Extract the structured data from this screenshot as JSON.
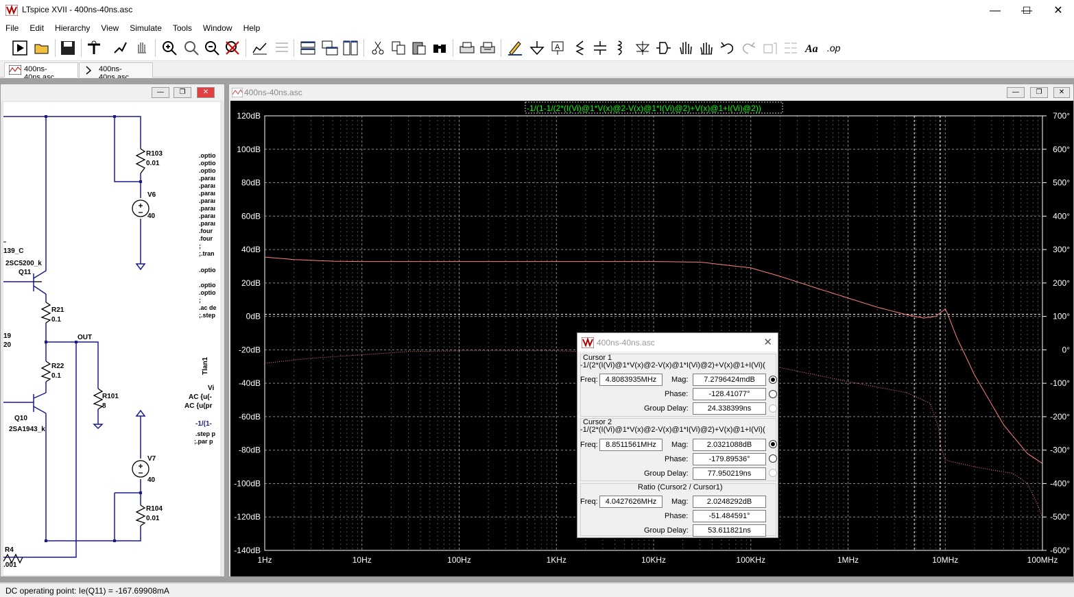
{
  "window": {
    "title": "LTspice XVII - 400ns-40ns.asc",
    "minimize": "—",
    "maximize": "☐",
    "close": "✕"
  },
  "menu": [
    "File",
    "Edit",
    "Hierarchy",
    "View",
    "Simulate",
    "Tools",
    "Window",
    "Help"
  ],
  "tabs": [
    {
      "label": "400ns-40ns.asc",
      "icon": "waveform-icon"
    },
    {
      "label": "400ns-40ns.asc",
      "icon": "schematic-icon"
    }
  ],
  "schematic": {
    "labels": {
      "r103": "R103",
      "r103v": "0.01",
      "v6": "V6",
      "v6v": "40",
      "q139": "139_C",
      "q11m": "2SC5200_k",
      "q11": "Q11",
      "r21": "R21",
      "r21v": "0.1",
      "r19": "19",
      "r19v": "20",
      "out": "OUT",
      "r22": "R22",
      "r22v": "0.1",
      "r101": "R101",
      "r101v": "8",
      "q10": "Q10",
      "q10m": "2SA1943_k",
      "v7": "V7",
      "v7v": "40",
      "r104": "R104",
      "r104v": "0.01",
      "r4": "R4",
      "r4v": ".001",
      "vi": "Vi",
      "ac1": "AC {u(-",
      "ac2": "AC {u(pr",
      "tlan": "Tlan1",
      "expr": "-1/(1-",
      "step1": ".step p",
      "par": ";.par p"
    },
    "directives": [
      ".optio",
      ".optio",
      ".optio",
      ".paraı",
      ".paraı",
      ".paraı",
      ".paraı",
      ".paraı",
      ".paraı",
      ".paraı",
      ".four",
      ".four",
      ";",
      ";.tran",
      "",
      ".optio",
      "",
      ".optio",
      ".optio",
      ";",
      ".ac de",
      ";.step"
    ]
  },
  "plot": {
    "window_title": "400ns-40ns.asc",
    "expression": "-1/(1-1/(2*(I(Vi)@1*V(x)@2-V(x)@1*I(Vi)@2)+V(x)@1+I(Vi)@2))",
    "colors": {
      "background": "#000000",
      "grid": "#8c8c8c",
      "trace": "#ff8080",
      "expr": "#00ff00"
    }
  },
  "chart_data": {
    "type": "line",
    "title": "-1/(1-1/(2*(I(Vi)@1*V(x)@2-V(x)@1*I(Vi)@2)+V(x)@1+I(Vi)@2))",
    "x_scale": "log",
    "xlim": [
      1,
      100000000
    ],
    "x_ticks": [
      "1Hz",
      "10Hz",
      "100Hz",
      "1KHz",
      "10KHz",
      "100KHz",
      "1MHz",
      "10MHz",
      "100MHz"
    ],
    "ylim_left": [
      -140,
      120
    ],
    "y_ticks_left": [
      "120dB",
      "100dB",
      "80dB",
      "60dB",
      "40dB",
      "20dB",
      "0dB",
      "-20dB",
      "-40dB",
      "-60dB",
      "-80dB",
      "-100dB",
      "-120dB",
      "-140dB"
    ],
    "ylim_right": [
      -600,
      700
    ],
    "y_ticks_right": [
      "700°",
      "600°",
      "500°",
      "400°",
      "300°",
      "200°",
      "100°",
      "0°",
      "-100°",
      "-200°",
      "-300°",
      "-400°",
      "-500°",
      "-600°"
    ],
    "grid": true,
    "cursor_lines_hz": [
      4808393.5,
      8851156.1
    ],
    "series": [
      {
        "axis": "left",
        "style": "solid",
        "x": [
          1,
          2,
          5,
          10,
          100,
          1000,
          10000,
          30000,
          100000,
          200000,
          500000,
          1000000,
          2000000,
          4000000,
          6000000,
          8000000,
          9500000,
          10000000,
          10500000,
          13000000,
          20000000,
          40000000,
          70000000,
          100000000
        ],
        "values": [
          35.5,
          34,
          33,
          32.8,
          32.8,
          32.8,
          32.8,
          32.5,
          29,
          24,
          16.5,
          11,
          5.5,
          1,
          -1,
          0,
          3.5,
          4.5,
          2,
          -12,
          -35,
          -65,
          -82,
          -88
        ]
      },
      {
        "axis": "right",
        "style": "dotted",
        "x": [
          1,
          3,
          10,
          30,
          100,
          1000,
          10000,
          100000,
          1000000,
          4000000,
          7000000,
          8500000,
          9000000,
          10000000,
          20000000,
          50000000,
          70000000,
          85000000,
          100000000
        ],
        "values": [
          -40,
          -25,
          -15,
          -5,
          -3,
          -3,
          -10,
          -35,
          -95,
          -128,
          -160,
          -230,
          -290,
          -330,
          -350,
          -370,
          -400,
          -450,
          -500
        ]
      }
    ]
  },
  "cursor_dialog": {
    "title": "400ns-40ns.asc",
    "cursor1": {
      "heading": "Cursor 1",
      "expr": "-1/(2*(I(Vi)@1*V(x)@2-V(x)@1*I(Vi)@2)+V(x)@1+I(Vi)(",
      "freq_label": "Freq:",
      "freq": "4.8083935MHz",
      "mag_label": "Mag:",
      "mag": "7.2796424mdB",
      "phase_label": "Phase:",
      "phase": "-128.41077°",
      "gd_label": "Group Delay:",
      "gd": "24.338399ns"
    },
    "cursor2": {
      "heading": "Cursor 2",
      "expr": "-1/(2*(I(Vi)@1*V(x)@2-V(x)@1*I(Vi)@2)+V(x)@1+I(Vi)(",
      "freq_label": "Freq:",
      "freq": "8.8511561MHz",
      "mag_label": "Mag:",
      "mag": "2.0321088dB",
      "phase_label": "Phase:",
      "phase": "-179.89536°",
      "gd_label": "Group Delay:",
      "gd": "77.950219ns"
    },
    "ratio": {
      "heading": "Ratio (Cursor2 / Cursor1)",
      "freq_label": "Freq:",
      "freq": "4.0427626MHz",
      "mag_label": "Mag:",
      "mag": "2.0248292dB",
      "phase_label": "Phase:",
      "phase": "-51.484591°",
      "gd_label": "Group Delay:",
      "gd": "53.611821ns"
    }
  },
  "status": {
    "text": "DC operating point: Ie(Q11) = -167.69908mA"
  }
}
